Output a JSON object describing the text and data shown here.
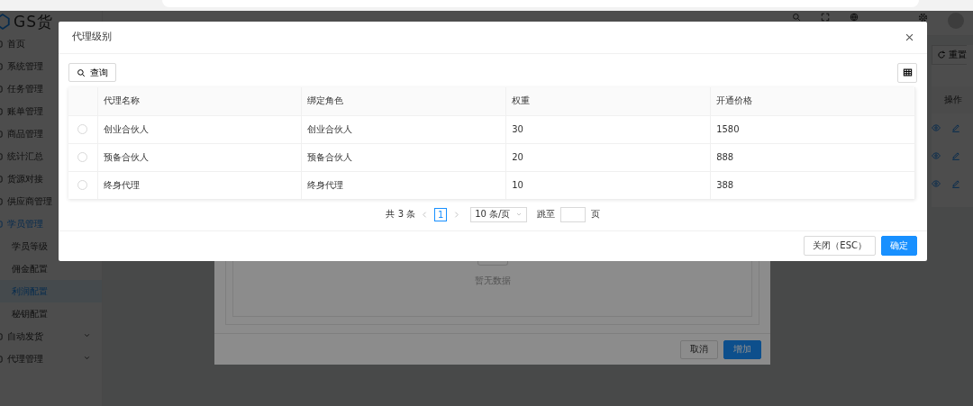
{
  "app": {
    "logo": "GS货",
    "sidebar": {
      "items": [
        {
          "label": "首页",
          "selected": false
        },
        {
          "label": "系统管理",
          "selected": false
        },
        {
          "label": "任务管理",
          "selected": false
        },
        {
          "label": "账单管理",
          "selected": false
        },
        {
          "label": "商品管理",
          "selected": false
        },
        {
          "label": "统计汇总",
          "selected": false
        },
        {
          "label": "货源对接",
          "selected": false
        },
        {
          "label": "供应商管理",
          "selected": false
        },
        {
          "label": "学员管理",
          "selected": true,
          "expanded": true,
          "children": [
            {
              "label": "学员等级",
              "selected": false
            },
            {
              "label": "佣金配置",
              "selected": false
            },
            {
              "label": "利润配置",
              "selected": true
            },
            {
              "label": "秘钥配置",
              "selected": false
            }
          ]
        },
        {
          "label": "自动发货",
          "selected": false,
          "expanded": false
        },
        {
          "label": "代理管理",
          "selected": false,
          "expanded": false
        }
      ]
    },
    "content": {
      "reset_button": "重置",
      "action_column": "操作",
      "action_rows": [
        {
          "kind": "view-edit"
        },
        {
          "kind": "view-edit"
        },
        {
          "kind": "view-edit"
        }
      ]
    }
  },
  "back_dialog": {
    "empty_text": "暂无数据",
    "buttons": [
      {
        "label": "取消",
        "kind": "default"
      },
      {
        "label": "增加",
        "kind": "primary"
      }
    ]
  },
  "dialog": {
    "title": "代理级别",
    "search_button": "查询",
    "table": {
      "columns": [
        "代理名称",
        "绑定角色",
        "权重",
        "开通价格"
      ],
      "rows": [
        {
          "selected": false,
          "cells": [
            "创业合伙人",
            "创业合伙人",
            "30",
            "1580"
          ]
        },
        {
          "selected": false,
          "cells": [
            "预备合伙人",
            "预备合伙人",
            "20",
            "888"
          ]
        },
        {
          "selected": false,
          "cells": [
            "终身代理",
            "终身代理",
            "10",
            "388"
          ]
        }
      ]
    },
    "pagination": {
      "total": "共 3 条",
      "pages": [
        {
          "label": "1",
          "selected": true
        }
      ],
      "page_size": "10 条/页",
      "jump_label": "跳至",
      "jump_suffix": "页"
    },
    "buttons": [
      {
        "label": "关闭（ESC）",
        "kind": "default"
      },
      {
        "label": "确定",
        "kind": "primary"
      }
    ]
  }
}
